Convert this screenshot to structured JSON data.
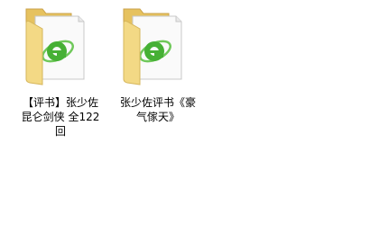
{
  "files": [
    {
      "name": "【评书】张少佐昆仑剑侠 全122回",
      "icon": "folder-with-ie-icon",
      "lines": [
        "【评书】张少佐",
        "昆仑剑侠 全122",
        "回"
      ]
    },
    {
      "name": "张少佐评书《豪气傢天》",
      "icon": "folder-with-ie-icon",
      "lines": [
        "张少佐评书《豪",
        "气傢天》"
      ]
    }
  ],
  "colors": {
    "background": "#ffffff",
    "folder_front": "#f3d985",
    "folder_back": "#e6c25f",
    "ie_green": "#46b035"
  }
}
